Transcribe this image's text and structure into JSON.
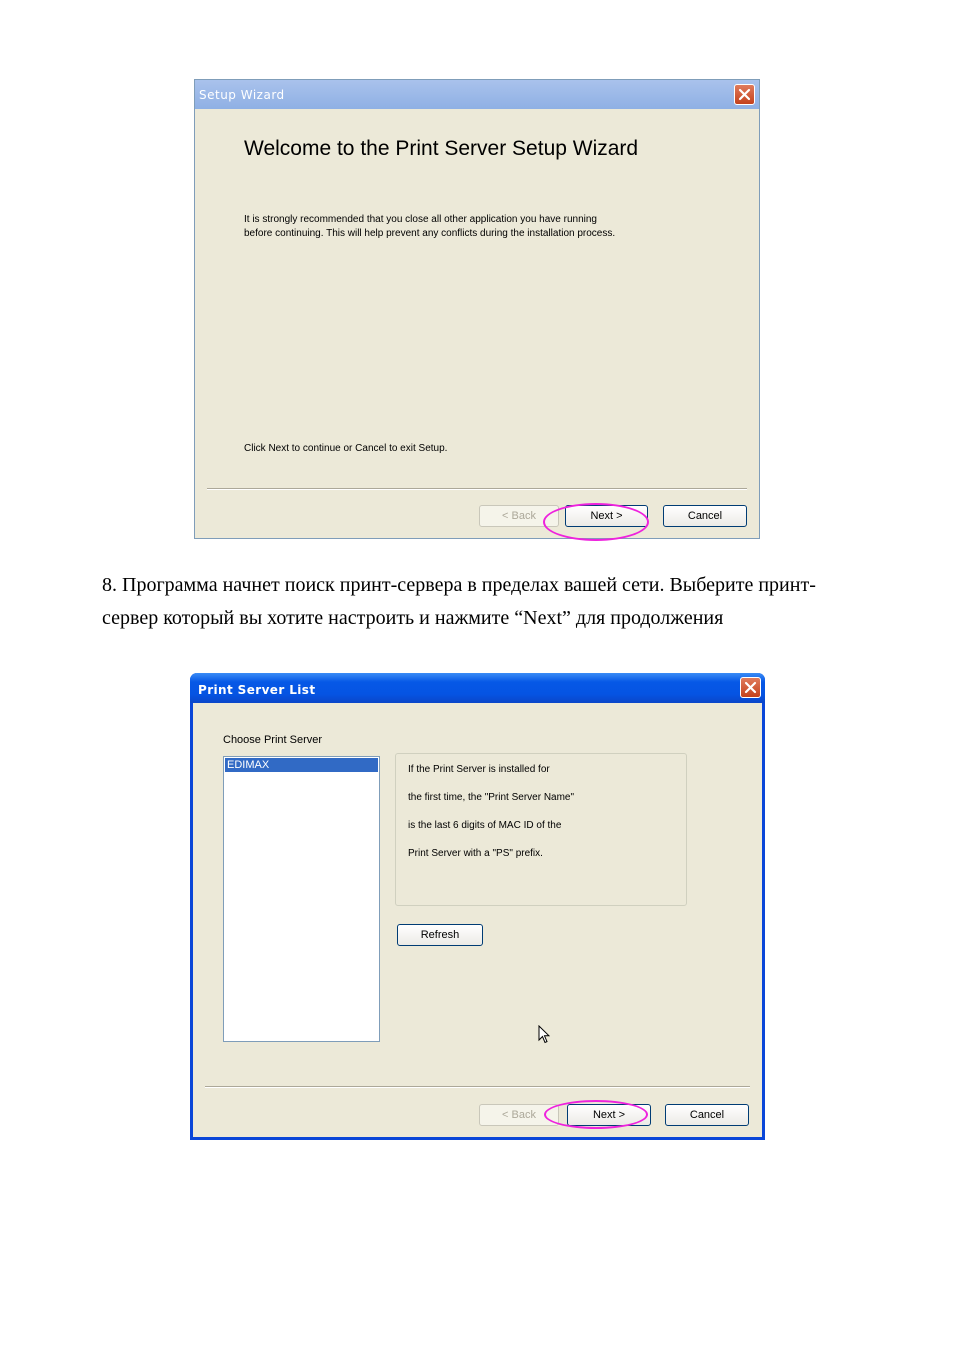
{
  "dialog1": {
    "title": "Setup Wizard",
    "heading": "Welcome to the Print Server Setup Wizard",
    "intro": "It is strongly recommended that you close all other application you have running before continuing. This will help prevent any conflicts during the installation process.",
    "footer": "Click Next to continue or Cancel to exit Setup.",
    "buttons": {
      "back": "< Back",
      "next": "Next >",
      "cancel": "Cancel"
    }
  },
  "instruction": "8. Программа начнет поиск принт-сервера в пределах вашей сети. Выберите принт-сервер который вы хотите настроить и нажмите “Next” для продолжения",
  "dialog2": {
    "title": "Print Server List",
    "list_label": "Choose Print Server",
    "list_items": [
      "EDIMAX"
    ],
    "info_lines": [
      "If the Print Server is installed for",
      "the first time, the \"Print Server Name\"",
      "is the last 6 digits of MAC ID of the",
      "Print Server with a \"PS\" prefix."
    ],
    "refresh": "Refresh",
    "buttons": {
      "back": "< Back",
      "next": "Next >",
      "cancel": "Cancel"
    }
  },
  "colors": {
    "highlight": "#ee22dd",
    "dialog_bg": "#ece9d8",
    "xp_titlebar": "#0554e3",
    "selection": "#316ac5"
  },
  "icons": [
    "close-icon",
    "mouse-pointer-icon"
  ]
}
